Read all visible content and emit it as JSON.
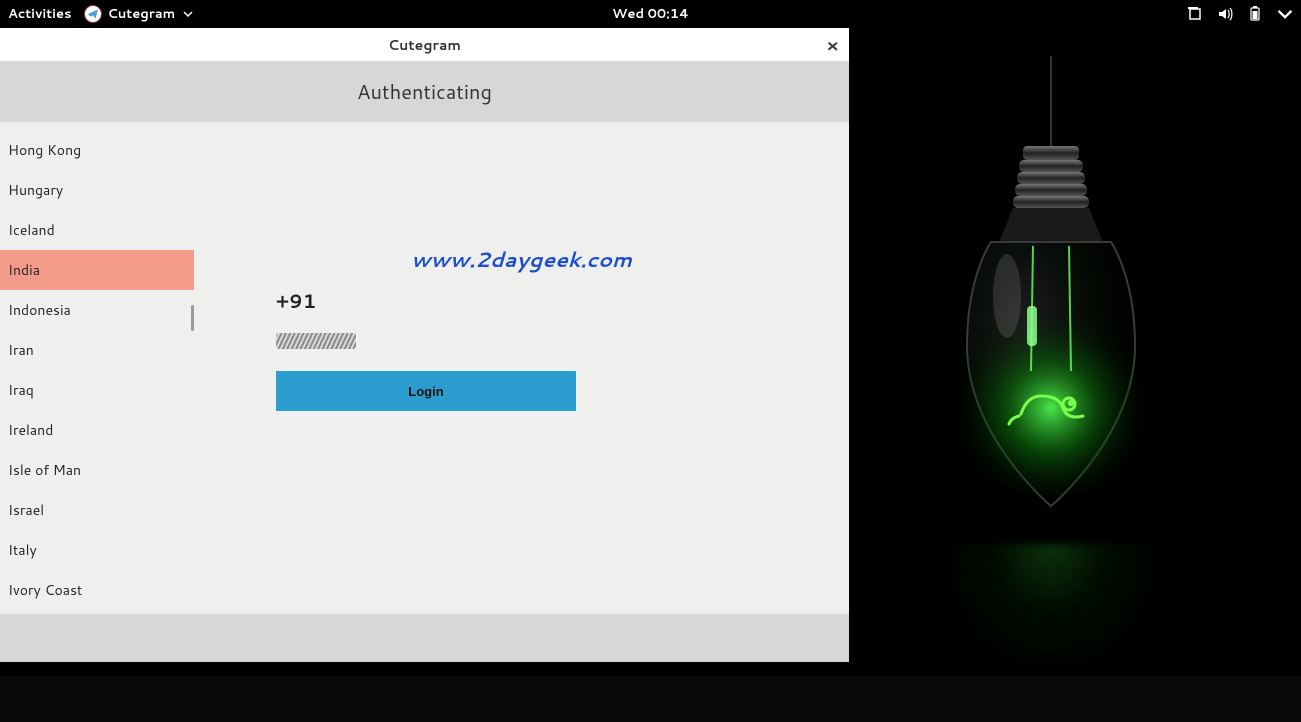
{
  "topbar": {
    "activities": "Activities",
    "app_name": "Cutegram",
    "clock": "Wed 00:14"
  },
  "window": {
    "title": "Cutegram",
    "close_glyph": "×",
    "auth_heading": "Authenticating",
    "countries": [
      {
        "name": "Hong Kong",
        "selected": false
      },
      {
        "name": "Hungary",
        "selected": false
      },
      {
        "name": "Iceland",
        "selected": false
      },
      {
        "name": "India",
        "selected": true
      },
      {
        "name": "Indonesia",
        "selected": false
      },
      {
        "name": "Iran",
        "selected": false
      },
      {
        "name": "Iraq",
        "selected": false
      },
      {
        "name": "Ireland",
        "selected": false
      },
      {
        "name": "Isle of Man",
        "selected": false
      },
      {
        "name": "Israel",
        "selected": false
      },
      {
        "name": "Italy",
        "selected": false
      },
      {
        "name": "Ivory Coast",
        "selected": false
      }
    ],
    "dial_code": "+91",
    "phone_value": "",
    "login_label": "Login"
  },
  "watermark": "www.2daygeek.com",
  "colors": {
    "accent": "#2c9dcf",
    "selected_country": "#f29b8a",
    "bulb_glow": "#1fbf1f"
  }
}
